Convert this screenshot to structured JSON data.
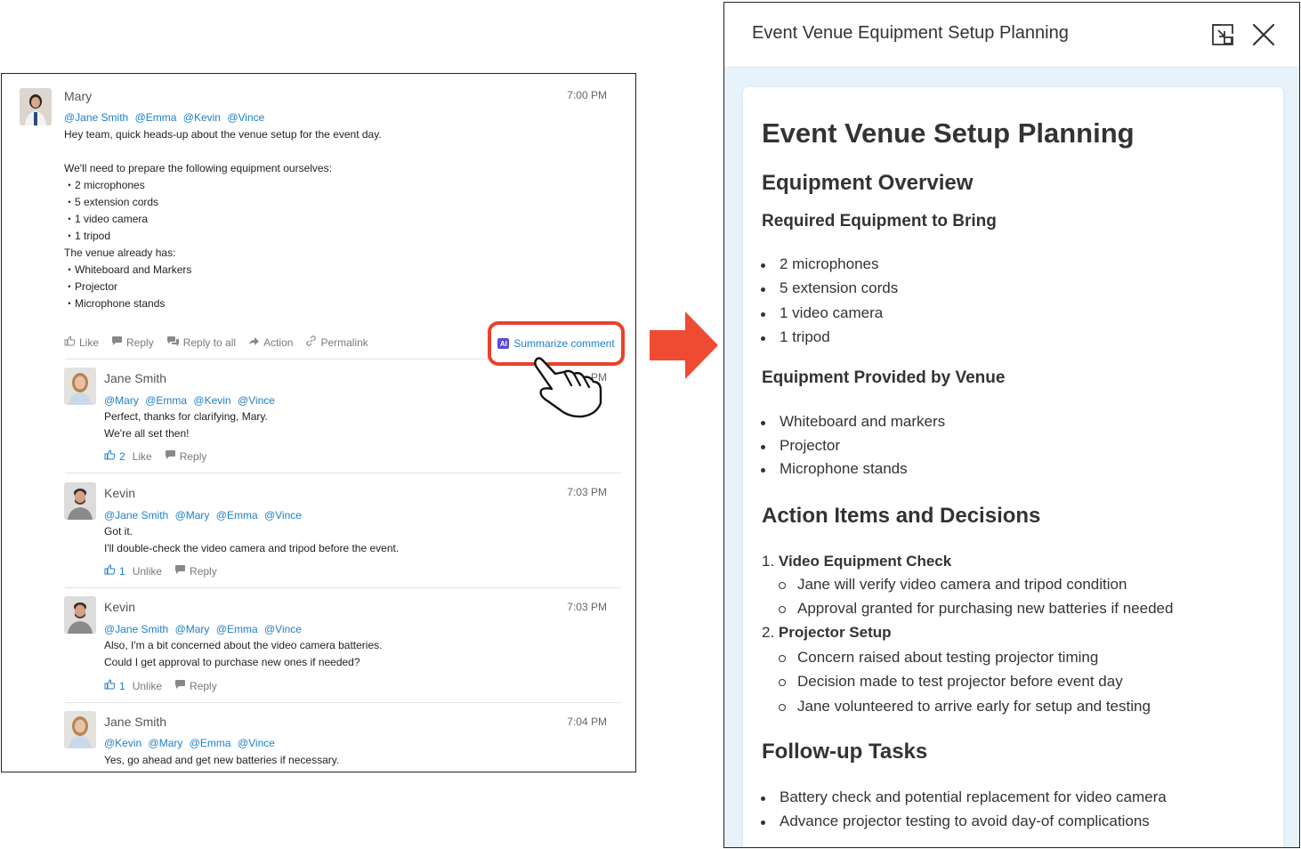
{
  "thread": {
    "comments": [
      {
        "author": "Mary",
        "time": "7:00 PM",
        "mentions": [
          "@Jane Smith",
          "@Emma",
          "@Kevin",
          "@Vince"
        ],
        "lines": [
          "Hey team, quick heads-up about the venue setup for the event day.",
          "",
          "We'll need to prepare the following equipment ourselves:",
          "・2 microphones",
          "・5 extension cords",
          "・1 video camera",
          "・1 tripod",
          "The venue already has:",
          "・Whiteboard and Markers",
          "・Projector",
          "・Microphone stands"
        ],
        "actions": {
          "like": "Like",
          "reply": "Reply",
          "reply_all": "Reply to all",
          "action": "Action",
          "permalink": "Permalink"
        }
      },
      {
        "author": "Jane Smith",
        "time": "PM",
        "mentions": [
          "@Mary",
          "@Emma",
          "@Kevin",
          "@Vince"
        ],
        "lines": [
          "Perfect, thanks for clarifying, Mary.",
          "We're all set then!"
        ],
        "like_count": "2",
        "like_label": "Like",
        "reply_label": "Reply"
      },
      {
        "author": "Kevin",
        "time": "7:03 PM",
        "mentions": [
          "@Jane Smith",
          "@Mary",
          "@Emma",
          "@Vince"
        ],
        "lines": [
          "Got it.",
          "I'll double-check the video camera and tripod before the event."
        ],
        "like_count": "1",
        "like_label": "Unlike",
        "reply_label": "Reply"
      },
      {
        "author": "Kevin",
        "time": "7:03 PM",
        "mentions": [
          "@Jane Smith",
          "@Mary",
          "@Emma",
          "@Vince"
        ],
        "lines": [
          "Also, I'm a bit concerned about the video camera batteries.",
          "Could I get approval to purchase new ones if needed?"
        ],
        "like_count": "1",
        "like_label": "Unlike",
        "reply_label": "Reply"
      },
      {
        "author": "Jane Smith",
        "time": "7:04 PM",
        "mentions": [
          "@Kevin",
          "@Mary",
          "@Emma",
          "@Vince"
        ],
        "lines": [
          "Yes, go ahead and get new batteries if necessary."
        ]
      }
    ],
    "summarize": {
      "ai_badge": "AI",
      "label": "Summarize comment"
    }
  },
  "panel": {
    "title": "Event Venue Equipment Setup Planning",
    "doc": {
      "title": "Event Venue Setup Planning",
      "equipment_overview": "Equipment Overview",
      "required_heading": "Required Equipment to Bring",
      "required_items": [
        "2 microphones",
        "5 extension cords",
        "1 video camera",
        "1 tripod"
      ],
      "venue_heading": "Equipment Provided by Venue",
      "venue_items": [
        "Whiteboard and markers",
        "Projector",
        "Microphone stands"
      ],
      "actions_heading": "Action Items and Decisions",
      "action_groups": [
        {
          "num": "1.",
          "title": "Video Equipment Check",
          "items": [
            "Jane will verify video camera and tripod condition",
            "Approval granted for purchasing new batteries if needed"
          ]
        },
        {
          "num": "2.",
          "title": "Projector Setup",
          "items": [
            "Concern raised about testing projector timing",
            "Decision made to test projector before event day",
            "Jane volunteered to arrive early for setup and testing"
          ]
        }
      ],
      "followup_heading": "Follow-up Tasks",
      "followup_items": [
        "Battery check and potential replacement for video camera",
        "Advance projector testing to avoid day-of complications"
      ]
    }
  },
  "colors": {
    "mention": "#1f7fc9",
    "highlight": "#e8412c",
    "arrow": "#ef4b32",
    "ai_badge": "#5b4bd6",
    "panel_bg": "#e8f2fb"
  },
  "icons": {
    "like": "thumbs-up-icon",
    "reply": "speech-bubble-icon",
    "action": "arrow-forward-icon",
    "permalink": "link-icon",
    "expand": "shrink-window-icon",
    "close": "close-icon",
    "pointer": "hand-pointer-icon"
  }
}
